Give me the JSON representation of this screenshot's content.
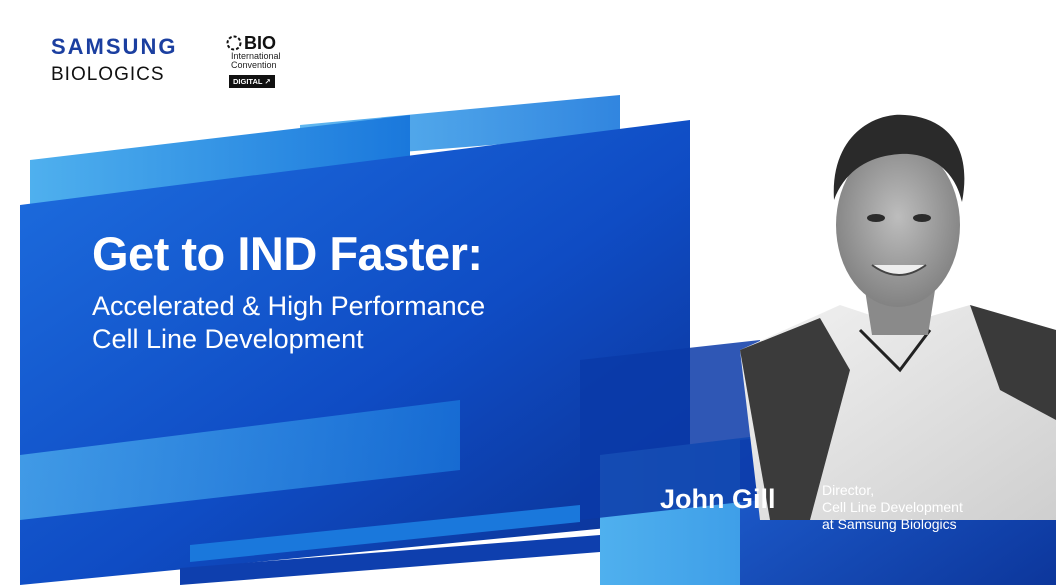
{
  "brand": {
    "line1": "SAMSUNG",
    "line2": "BIOLOGICS",
    "primary_color": "#1b3fa0"
  },
  "event_logo": {
    "name": "BIO",
    "line1": "International",
    "line2": "Convention",
    "badge": "DIGITAL ↗"
  },
  "headline": {
    "title": "Get to IND Faster:",
    "subtitle_line1": "Accelerated & High Performance",
    "subtitle_line2": "Cell Line Development"
  },
  "speaker": {
    "name": "John Gill",
    "role_line1": "Director,",
    "role_line2": "Cell Line Development",
    "role_line3": "at Samsung Biologics",
    "photo_icon": "speaker-portrait"
  },
  "colors": {
    "blue_dark": "#0b3fb6",
    "blue_mid": "#1560d6",
    "blue_light": "#2a8de6"
  }
}
